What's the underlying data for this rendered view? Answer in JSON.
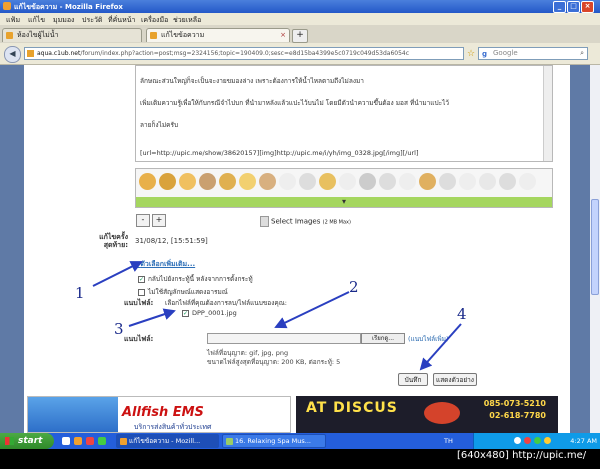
{
  "window": {
    "title": "แก้ไขข้อความ - Mozilla Firefox",
    "buttons": {
      "minimize": "_",
      "maximize": "□",
      "close": "×"
    }
  },
  "menu": [
    "แฟ้ม",
    "แก้ไข",
    "มุมมอง",
    "ประวัติ",
    "ที่คั่นหน้า",
    "เครื่องมือ",
    "ช่วยเหลือ"
  ],
  "tabs": [
    {
      "label": "ห้องไขผู้ไม่น้ำ",
      "active": false
    },
    {
      "label": "แก้ไขข้อความ",
      "active": true
    }
  ],
  "nav": {
    "url_host": "aqua.c1ub.net",
    "url_rest": "/forum/index.php?action=post;msg=2324156;topic=190409.0;sesc=e8d15ba4399e5c0719c049d53da6054c",
    "search_placeholder": "Google",
    "search_engine_letter": "g"
  },
  "editor": {
    "lines": [
      "ลักษณะส่วนใหญ่ก็จะเป็นจะงายขมองล่าง เพราะต้องการให้น้ำไหลตามถึงไม่ลงมา",
      "เพิ่มเติมความรู้เพื่อให้กับกรณีจำไปบก ที่นำมาหลังแล้วแปะไว้บนไม่ โดยมีตัวนำความขึ้นต้อง มอส ที่นำมาแปะไว้",
      "ลายก็งไม่ครับ",
      "[url=http://upic.me/show/38620157][img]http://upic.me/i/yh/img_0328.jpg[/img][/url]"
    ]
  },
  "smilies_more": "▾",
  "resize": {
    "minus": "-",
    "plus": "+"
  },
  "select_images": {
    "label": "Select Images",
    "limit": "(2 MB Max)"
  },
  "last_edit": {
    "label_line1": "แก้ไขครั้ง",
    "label_line2": "สุดท้าย:",
    "value": "31/08/12, [15:51:59]"
  },
  "options": {
    "toggle_label": "ตัวเลือกเพิ่มเติม...",
    "checkbox1": "กลับไปยังกระทู้นี้ หลังจากการตั้งกระทู้",
    "checkbox2": "ไม่ใช้สัญลักษณ์แสดงอารมณ์"
  },
  "attach_existing": {
    "label": "แนบไฟล์:",
    "hint": "เลือกไฟล์ที่คุณต้องการลบ/ไฟล์แนบของคุณ:",
    "file": "DPP_0001.jpg"
  },
  "attach_new": {
    "label": "แนบไฟล์:",
    "browse": "เรียกดู...",
    "more": "(แนบไฟล์เพิ่ม)",
    "note1": "ไฟล์ที่อนุญาต: gif, jpg, png",
    "note2": "ขนาดไฟล์สูงสุดที่อนุญาต: 200 KB, ต่อกระทู้: 5"
  },
  "actions": {
    "save": "บันทึก",
    "preview": "แสดงตัวอย่าง"
  },
  "banners": {
    "left_brand": "Allfish EMS",
    "left_sub": "บริการส่งสินค้าทั่วประเทศ",
    "right_brand": "AT DISCUS",
    "right_phone1": "085-073-5210",
    "right_phone2": "02-618-7780"
  },
  "taskbar": {
    "start": "start",
    "tasks": [
      {
        "label": "แก้ไขข้อความ - Mozill...",
        "active": true
      },
      {
        "label": "16. Relaxing Spa Mus...",
        "active": false
      }
    ],
    "lang": "TH",
    "clock": "4:27 AM"
  },
  "annotations": [
    "1",
    "2",
    "3",
    "4"
  ],
  "caption": "[640x480] http://upic.me/",
  "colors": {
    "accent": "#2458c8",
    "annotation": "#1a2a8a",
    "link": "#2d6fb7"
  }
}
